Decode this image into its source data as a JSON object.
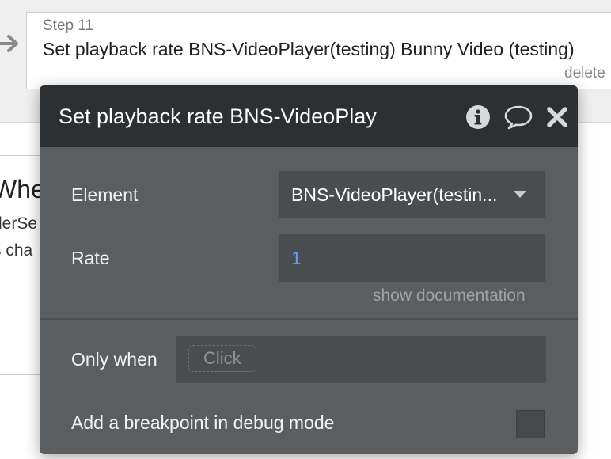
{
  "step": {
    "label": "Step 11",
    "title": "Set playback rate BNS-VideoPlayer(testing) Bunny Video (testing)",
    "delete_label": "delete"
  },
  "event": {
    "title_fragment": "Whe",
    "line1": "derSe",
    "line2": "s cha"
  },
  "popup": {
    "title": "Set playback rate BNS-VideoPlay",
    "fields": {
      "element_label": "Element",
      "element_value": "BNS-VideoPlayer(testin...",
      "rate_label": "Rate",
      "rate_value": "1"
    },
    "show_documentation": "show documentation",
    "only_when_label": "Only when",
    "only_when_placeholder": "Click",
    "breakpoint_label": "Add a breakpoint in debug mode"
  },
  "colors": {
    "header_bg": "#2d3033",
    "body_bg": "#5b5e61",
    "input_bg": "#4a4d50",
    "rate_value_color": "#5aa7f5"
  },
  "icons": [
    "arrow-right-icon",
    "info-icon",
    "comment-icon",
    "close-icon",
    "chevron-down-icon"
  ]
}
